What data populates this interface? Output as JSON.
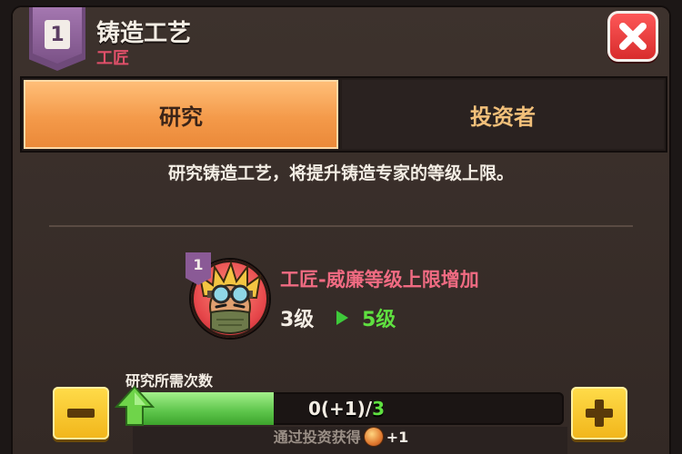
{
  "header": {
    "rank_number": "1",
    "title": "铸造工艺",
    "subtitle": "工匠"
  },
  "tabs": [
    {
      "label": "研究",
      "active": true
    },
    {
      "label": "投资者",
      "active": false
    }
  ],
  "description": "研究铸造工艺，将提升铸造专家的等级上限。",
  "reward": {
    "badge_number": "1",
    "title": "工匠-威廉等级上限增加",
    "level_from": "3级",
    "level_to": "5级"
  },
  "progress": {
    "label": "研究所需次数",
    "current_text": "0(+1)/",
    "goal_text": "3",
    "fill_fraction": 0.333
  },
  "footer": {
    "text": "通过投资获得",
    "plus_text": "+1"
  },
  "colors": {
    "accent_orange": "#f49a4a",
    "progress_green": "#5cc44a",
    "level_up_green": "#5fe040",
    "reward_pink": "#f06b82",
    "close_red": "#d62a2a",
    "button_yellow": "#f1b51a"
  }
}
